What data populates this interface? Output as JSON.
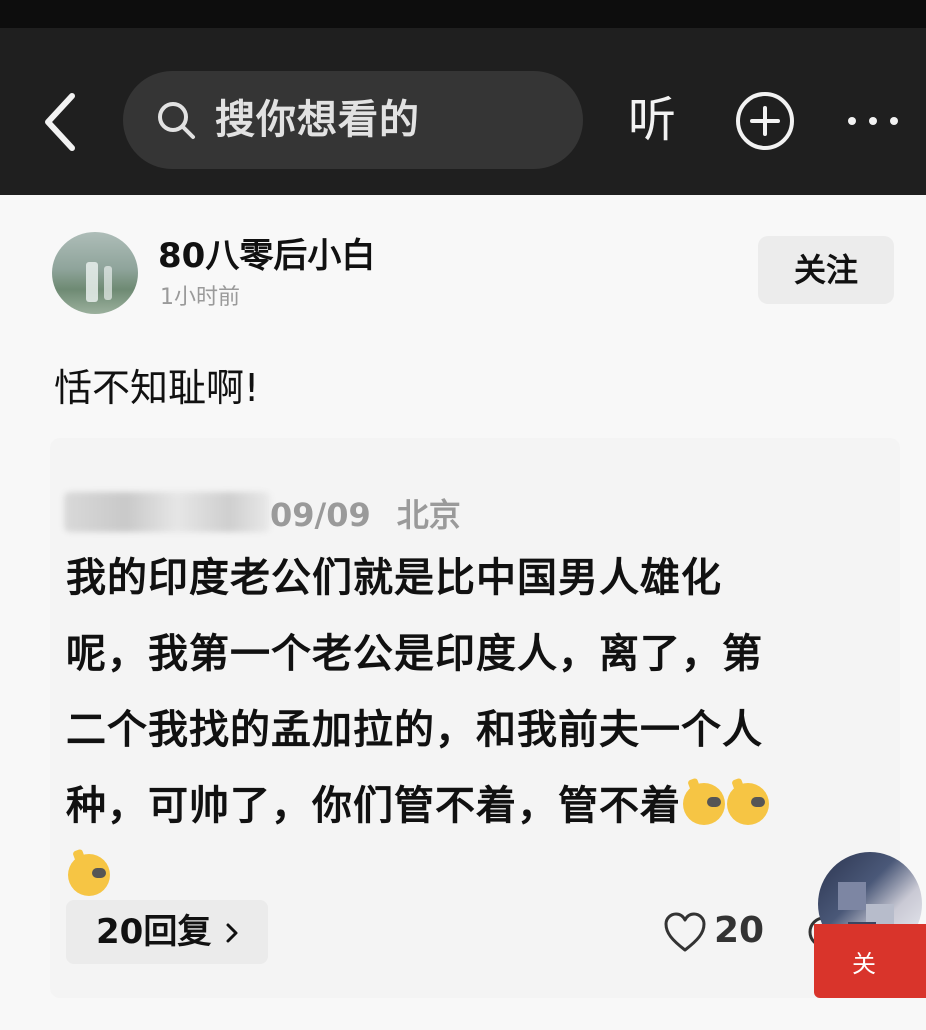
{
  "header": {
    "search_placeholder": "搜你想看的",
    "listen_label": "听"
  },
  "post": {
    "username": "80八零后小白",
    "time": "1小时前",
    "follow_label": "关注",
    "text": "恬不知耻啊!"
  },
  "quoted_comment": {
    "date": "09/09",
    "location": "北京",
    "lines": [
      "我的印度老公们就是比中国男人雄化",
      "呢，我第一个老公是印度人，离了，第",
      "二个我找的孟加拉的，和我前夫一个人",
      "种，可帅了，你们管不着，管不着"
    ],
    "replies_label": "20回复",
    "likes": "20"
  },
  "floating": {
    "follow_label": "关"
  },
  "colors": {
    "topbar": "#1f1f1f",
    "search_bg": "#353535",
    "follow_red": "#d9342b"
  }
}
